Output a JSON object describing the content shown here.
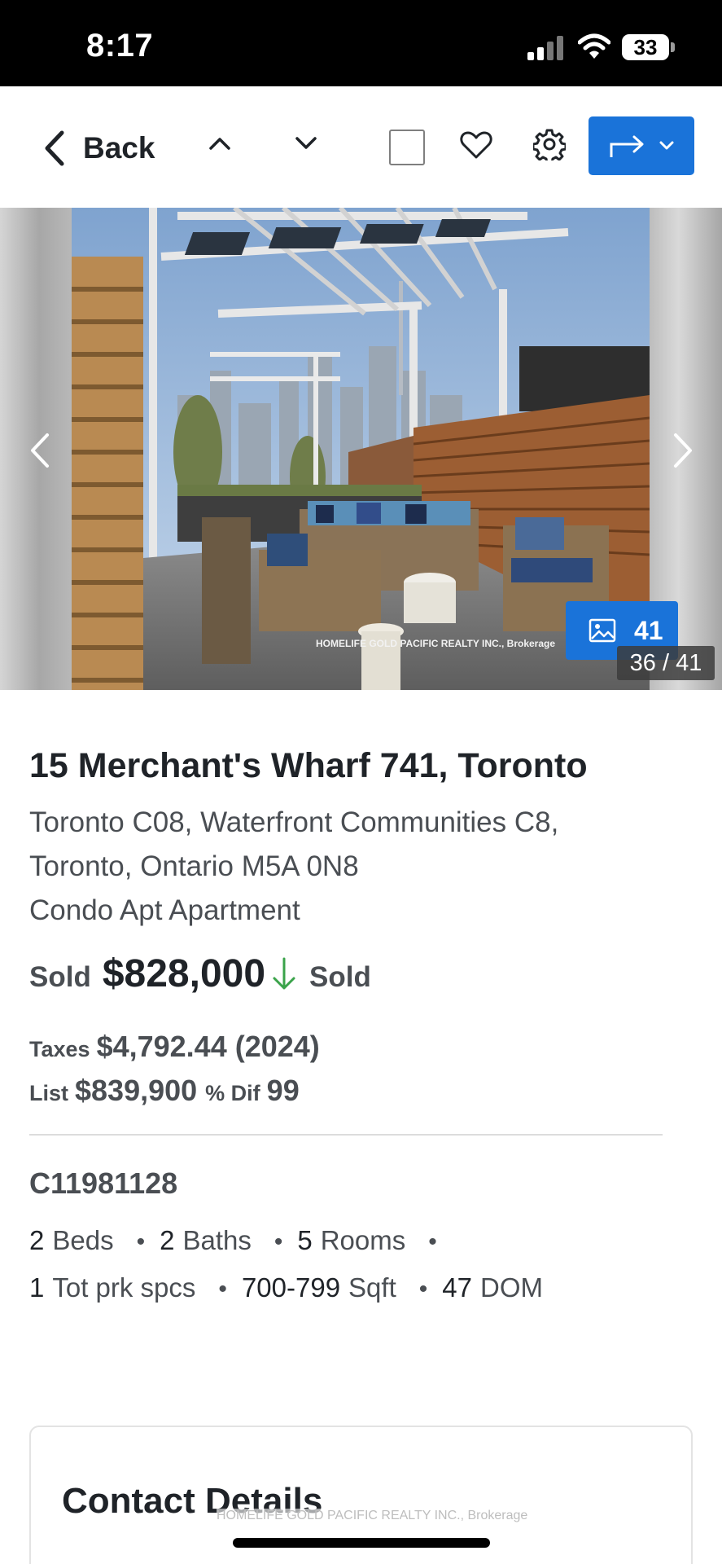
{
  "status_bar": {
    "time": "8:17",
    "battery": "33"
  },
  "toolbar": {
    "back_label": "Back"
  },
  "gallery": {
    "photo_count": "41",
    "photo_index": "36 / 41",
    "watermark": "HOMELIFE GOLD PACIFIC REALTY INC., Brokerage"
  },
  "listing": {
    "title": "15 Merchant's Wharf 741, Toronto",
    "address_lines": [
      "Toronto C08, Waterfront Communities C8,",
      "Toronto, Ontario M5A 0N8",
      "Condo Apt Apartment"
    ],
    "sold_label": "Sold",
    "sold_price": "$828,000",
    "sold_status": "Sold",
    "taxes_label": "Taxes",
    "taxes_value": "$4,792.44 (2024)",
    "list_label": "List",
    "list_value": "$839,900",
    "dif_label": "% Dif",
    "dif_value": "99",
    "mls_number": "C11981128",
    "features_row1": [
      {
        "num": "2",
        "label": "Beds"
      },
      {
        "num": "2",
        "label": "Baths"
      },
      {
        "num": "5",
        "label": "Rooms"
      }
    ],
    "features_row2": [
      {
        "num": "1",
        "label": "Tot prk spcs"
      },
      {
        "num": "700-799",
        "label": "Sqft"
      },
      {
        "num": "47",
        "label": "DOM"
      }
    ]
  },
  "contact": {
    "title": "Contact Details",
    "watermark": "HOMELIFE GOLD PACIFIC REALTY INC., Brokerage"
  },
  "colors": {
    "accent": "#1a73d9",
    "sold_arrow": "#3aa34a",
    "text_primary": "#1f2328",
    "text_secondary": "#4a4e53"
  }
}
